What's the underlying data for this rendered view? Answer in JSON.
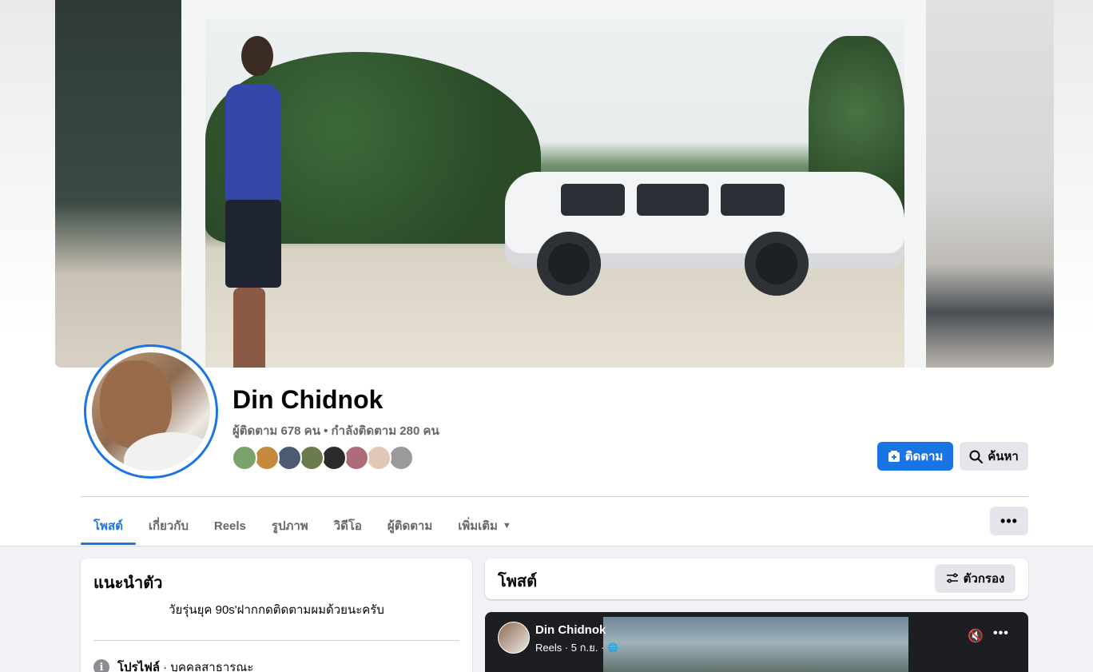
{
  "profile": {
    "name": "Din Chidnok",
    "stats": "ผู้ติดตาม 678 คน • กำลังติดตาม 280 คน",
    "follower_avatar_colors": [
      "#7aa36b",
      "#c58a3d",
      "#4d5a73",
      "#6b7b4e",
      "#2b2b2b",
      "#b06b7a",
      "#e3c6b6",
      "#9a9a9a"
    ]
  },
  "actions": {
    "follow_label": "ติดตาม",
    "search_label": "ค้นหา",
    "follow_icon": "follow-plus-icon",
    "search_icon": "search-icon",
    "more_label": "•••"
  },
  "tabs": [
    {
      "label": "โพสต์",
      "active": true
    },
    {
      "label": "เกี่ยวกับ",
      "active": false
    },
    {
      "label": "Reels",
      "active": false
    },
    {
      "label": "รูปภาพ",
      "active": false
    },
    {
      "label": "วิดีโอ",
      "active": false
    },
    {
      "label": "ผู้ติดตาม",
      "active": false
    },
    {
      "label": "เพิ่มเติม",
      "active": false,
      "caret": "▼"
    }
  ],
  "intro": {
    "title": "แนะนำตัว",
    "bio": "วัยรุ่นยุค 90s'ฝากกดติดตามผมด้วยนะครับ",
    "profile_label": "โปรไฟล์",
    "profile_value": " · บุคคลสาธารณะ",
    "info_icon": "i"
  },
  "posts": {
    "title": "โพสต์",
    "filter_label": "ตัวกรอง",
    "filter_icon": "filter-sliders-icon"
  },
  "reel": {
    "author": "Din Chidnok",
    "meta": "Reels · 5 ก.ย. ·",
    "globe": "🌐",
    "mute": "🔇",
    "dots": "•••"
  },
  "colors": {
    "accent": "#1b74e4",
    "secondary_button": "#e4e6eb",
    "feed_background": "#f0f2f5"
  }
}
